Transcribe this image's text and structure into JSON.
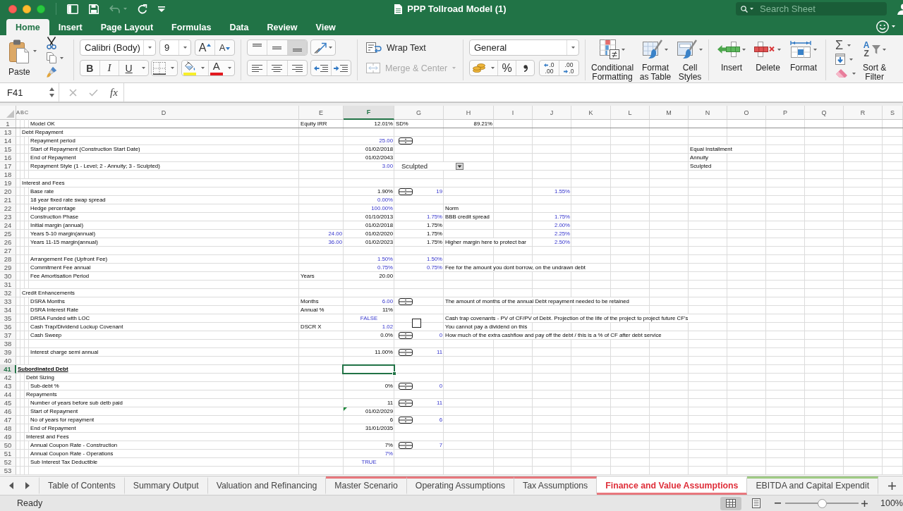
{
  "window": {
    "title": "PPP Tollroad Model (1)",
    "search_placeholder": "Search Sheet"
  },
  "quick_access": [
    {
      "kind": "sidebar",
      "disabled": false
    },
    {
      "kind": "save",
      "disabled": false
    },
    {
      "kind": "undo",
      "disabled": true
    },
    {
      "kind": "redo",
      "disabled": false
    },
    {
      "kind": "customize",
      "disabled": false
    }
  ],
  "ribbon_tabs": [
    {
      "label": "Home",
      "selected": true
    },
    {
      "label": "Insert",
      "selected": false
    },
    {
      "label": "Page Layout",
      "selected": false
    },
    {
      "label": "Formulas",
      "selected": false
    },
    {
      "label": "Data",
      "selected": false
    },
    {
      "label": "Review",
      "selected": false
    },
    {
      "label": "View",
      "selected": false
    }
  ],
  "ribbon": {
    "paste": "Paste",
    "font_name": "Calibri (Body)",
    "font_size": "9",
    "grow_font": "A",
    "shrink_font": "A",
    "bold": "B",
    "italic": "I",
    "underline": "U",
    "font_color": "A",
    "vertical_align": [
      {
        "kind": "top",
        "selected": false
      },
      {
        "kind": "middle",
        "selected": false
      },
      {
        "kind": "bottom",
        "selected": true
      }
    ],
    "horizontal_align": [
      {
        "kind": "left",
        "selected": false
      },
      {
        "kind": "center",
        "selected": false
      },
      {
        "kind": "right",
        "selected": false
      }
    ],
    "wrap_text": "Wrap Text",
    "merge_center": {
      "label": "Merge & Center",
      "disabled": true
    },
    "number_format": "General",
    "percent": "%",
    "add_decimal": [
      ".0",
      ".00"
    ],
    "remove_decimal": [
      ".00",
      ".0"
    ],
    "styles": [
      {
        "kind": "conditional",
        "label": "Conditional\nFormatting"
      },
      {
        "kind": "table",
        "label": "Format\nas Table"
      },
      {
        "kind": "cell_styles",
        "label": "Cell\nStyles"
      }
    ],
    "cells": [
      {
        "kind": "insert",
        "label": "Insert"
      },
      {
        "kind": "delete",
        "label": "Delete"
      },
      {
        "kind": "format",
        "label": "Format"
      }
    ],
    "autosum": "Σ",
    "sort_letters": [
      "A",
      "Z"
    ],
    "sort_filter": "Sort &\nFilter"
  },
  "formula_bar": {
    "name_box": "F41",
    "fx": "fx"
  },
  "sheet": {
    "columns": [
      {
        "letter": "A",
        "selected": false
      },
      {
        "letter": "B",
        "selected": false
      },
      {
        "letter": "C",
        "selected": false
      },
      {
        "letter": "D",
        "selected": false
      },
      {
        "letter": "E",
        "selected": false
      },
      {
        "letter": "F",
        "selected": true
      },
      {
        "letter": "G",
        "selected": false
      },
      {
        "letter": "H",
        "selected": false
      },
      {
        "letter": "I",
        "selected": false
      },
      {
        "letter": "J",
        "selected": false
      },
      {
        "letter": "K",
        "selected": false
      },
      {
        "letter": "L",
        "selected": false
      },
      {
        "letter": "M",
        "selected": false
      },
      {
        "letter": "N",
        "selected": false
      },
      {
        "letter": "O",
        "selected": false
      },
      {
        "letter": "P",
        "selected": false
      },
      {
        "letter": "Q",
        "selected": false
      },
      {
        "letter": "R",
        "selected": false
      },
      {
        "letter": "S",
        "selected": false
      }
    ],
    "rows": [
      {
        "number": "1",
        "selected": false,
        "cells": {
          "D": {
            "kind": "label",
            "text": "Model OK",
            "input": false
          },
          "E": {
            "kind": "label",
            "text": "Equity IRR",
            "input": false
          },
          "F": {
            "kind": "number",
            "text": "12.01%",
            "input": false
          },
          "G": {
            "kind": "label",
            "text": "SD%",
            "input": false
          },
          "H": {
            "kind": "number",
            "text": "89.21%",
            "input": false
          }
        }
      },
      {
        "number": "13",
        "selected": false,
        "cells": {
          "B": {
            "kind": "label",
            "text": "Debt Repayment",
            "input": false
          }
        }
      },
      {
        "number": "14",
        "selected": false,
        "cells": {
          "D": {
            "kind": "label",
            "text": "Repayment period",
            "input": false
          },
          "F": {
            "kind": "number",
            "text": "25.00",
            "input": true
          },
          "G": {
            "kind": "spinner"
          }
        }
      },
      {
        "number": "15",
        "selected": false,
        "cells": {
          "D": {
            "kind": "label",
            "text": "Start of Repayment (Construction Start Date)",
            "input": false
          },
          "F": {
            "kind": "number",
            "text": "01/02/2018",
            "input": false
          },
          "N": {
            "kind": "label",
            "text": "Equal Installment",
            "input": false
          }
        }
      },
      {
        "number": "16",
        "selected": false,
        "cells": {
          "D": {
            "kind": "label",
            "text": "End of Repayment",
            "input": false
          },
          "F": {
            "kind": "number",
            "text": "01/02/2043",
            "input": false
          },
          "N": {
            "kind": "label",
            "text": "Annuity",
            "input": false
          }
        }
      },
      {
        "number": "17",
        "selected": false,
        "cells": {
          "D": {
            "kind": "label",
            "text": "Repayment Style (1 - Level; 2 - Annuity; 3 - Sculpted)",
            "input": false
          },
          "F": {
            "kind": "number",
            "text": "3.00",
            "input": true
          },
          "G": {
            "kind": "dropdown",
            "text": "Sculpted"
          },
          "N": {
            "kind": "label",
            "text": "Sculpted",
            "input": false
          }
        }
      },
      {
        "number": "18",
        "selected": false
      },
      {
        "number": "19",
        "selected": false,
        "cells": {
          "B": {
            "kind": "label",
            "text": "Interest and Fees",
            "input": false
          }
        }
      },
      {
        "number": "20",
        "selected": false,
        "cells": {
          "D": {
            "kind": "label",
            "text": "Base rate",
            "input": false
          },
          "F": {
            "kind": "number",
            "text": "1.90%",
            "input": false
          },
          "G": [
            {
              "kind": "spinner"
            },
            {
              "kind": "number",
              "text": "19",
              "input": true
            }
          ],
          "J": {
            "kind": "number",
            "text": "1.55%",
            "input": true
          }
        }
      },
      {
        "number": "21",
        "selected": false,
        "cells": {
          "D": {
            "kind": "label",
            "text": "18 year fixed rate swap spread",
            "input": false
          },
          "F": {
            "kind": "number",
            "text": "0.00%",
            "input": true
          }
        }
      },
      {
        "number": "22",
        "selected": false,
        "cells": {
          "D": {
            "kind": "label",
            "text": "Hedge percentage",
            "input": false
          },
          "F": {
            "kind": "number",
            "text": "100.00%",
            "input": true
          },
          "H": {
            "kind": "label",
            "text": "Norm",
            "input": false
          }
        }
      },
      {
        "number": "23",
        "selected": false,
        "cells": {
          "D": {
            "kind": "label",
            "text": "Construction Phase",
            "input": false
          },
          "F": {
            "kind": "number",
            "text": "01/10/2013",
            "input": false
          },
          "G": {
            "kind": "number",
            "text": "1.75%",
            "input": true
          },
          "H": {
            "kind": "label",
            "text": "BBB credit spread",
            "input": false
          },
          "J": {
            "kind": "number",
            "text": "1.75%",
            "input": true
          }
        }
      },
      {
        "number": "24",
        "selected": false,
        "cells": {
          "D": {
            "kind": "label",
            "text": "Initial margin (annual)",
            "input": false
          },
          "F": {
            "kind": "number",
            "text": "01/02/2018",
            "input": false
          },
          "G": {
            "kind": "number",
            "text": "1.75%",
            "input": false
          },
          "J": {
            "kind": "number",
            "text": "2.00%",
            "input": true
          }
        }
      },
      {
        "number": "25",
        "selected": false,
        "cells": {
          "D": {
            "kind": "label",
            "text": "Years 5-10 margin(annual)",
            "input": false
          },
          "E": {
            "kind": "number",
            "text": "24.00",
            "input": true
          },
          "F": {
            "kind": "number",
            "text": "01/02/2020",
            "input": false
          },
          "G": {
            "kind": "number",
            "text": "1.75%",
            "input": false
          },
          "J": {
            "kind": "number",
            "text": "2.25%",
            "input": true
          }
        }
      },
      {
        "number": "26",
        "selected": false,
        "cells": {
          "D": {
            "kind": "label",
            "text": "Years 11-15 margin(annual)",
            "input": false
          },
          "E": {
            "kind": "number",
            "text": "36.00",
            "input": true
          },
          "F": {
            "kind": "number",
            "text": "01/02/2023",
            "input": false
          },
          "G": {
            "kind": "number",
            "text": "1.75%",
            "input": false
          },
          "H": {
            "kind": "label",
            "text": "Higher margin here to protect bar",
            "input": false
          },
          "J": {
            "kind": "number",
            "text": "2.50%",
            "input": true
          }
        }
      },
      {
        "number": "27",
        "selected": false
      },
      {
        "number": "28",
        "selected": false,
        "cells": {
          "D": {
            "kind": "label",
            "text": "Arrangement Fee (Upfront Fee)",
            "input": false
          },
          "F": {
            "kind": "number",
            "text": "1.50%",
            "input": true
          },
          "G": {
            "kind": "number",
            "text": "1.50%",
            "input": true
          }
        }
      },
      {
        "number": "29",
        "selected": false,
        "cells": {
          "D": {
            "kind": "label",
            "text": "Commitment Fee annual",
            "input": false
          },
          "F": {
            "kind": "number",
            "text": "0.75%",
            "input": true
          },
          "G": {
            "kind": "number",
            "text": "0.75%",
            "input": true
          },
          "H": {
            "kind": "label",
            "text": "Fee for the amount you dont borrow, on the undrawn debt",
            "input": false
          }
        }
      },
      {
        "number": "30",
        "selected": false,
        "cells": {
          "D": {
            "kind": "label",
            "text": "Fee Amortisation Period",
            "input": false
          },
          "E": {
            "kind": "label",
            "text": "Years",
            "input": false
          },
          "F": {
            "kind": "number",
            "text": "20.00",
            "input": false
          }
        }
      },
      {
        "number": "31",
        "selected": false
      },
      {
        "number": "32",
        "selected": false,
        "cells": {
          "B": {
            "kind": "label",
            "text": "Credit Enhancements",
            "input": false
          }
        }
      },
      {
        "number": "33",
        "selected": false,
        "cells": {
          "D": {
            "kind": "label",
            "text": "DSRA Months",
            "input": false
          },
          "E": {
            "kind": "label",
            "text": "Months",
            "input": false
          },
          "F": {
            "kind": "number",
            "text": "6.00",
            "input": true
          },
          "G": {
            "kind": "spinner"
          },
          "H": {
            "kind": "label",
            "text": "The amount of months of the annual Debt repayment needed to be retained",
            "input": false
          }
        }
      },
      {
        "number": "34",
        "selected": false,
        "cells": {
          "D": {
            "kind": "label",
            "text": "DSRA Interest Rate",
            "input": false
          },
          "E": {
            "kind": "label",
            "text": "Annual %",
            "input": false
          },
          "F": {
            "kind": "number",
            "text": "11%",
            "input": false
          }
        }
      },
      {
        "number": "35",
        "selected": false,
        "cells": {
          "D": {
            "kind": "label",
            "text": "DRSA Funded with LOC",
            "input": false
          },
          "F": {
            "kind": "boolean",
            "text": "FALSE",
            "input": true
          },
          "G": {
            "kind": "checkbox",
            "checked": false
          },
          "H": {
            "kind": "label",
            "text": "Cash trap covenants - PV of CF/PV of Debt. Projection of the life of the project to project future CF's",
            "input": false
          }
        }
      },
      {
        "number": "36",
        "selected": false,
        "cells": {
          "D": {
            "kind": "label",
            "text": "Cash Trap/Dividend Lockup Covenant",
            "input": false
          },
          "E": {
            "kind": "label",
            "text": "DSCR X",
            "input": false
          },
          "F": {
            "kind": "number",
            "text": "1.02",
            "input": true
          },
          "H": {
            "kind": "label",
            "text": "You cannot pay a dividend on this",
            "input": false
          }
        }
      },
      {
        "number": "37",
        "selected": false,
        "cells": {
          "D": {
            "kind": "label",
            "text": "Cash Sweep",
            "input": false
          },
          "F": {
            "kind": "number",
            "text": "0.0%",
            "input": false
          },
          "G": [
            {
              "kind": "spinner"
            },
            {
              "kind": "number",
              "text": "0",
              "input": true
            }
          ],
          "H": {
            "kind": "label",
            "text": "How much of the extra cashflow and pay off the debt / this is a % of CF after debt service",
            "input": false
          }
        }
      },
      {
        "number": "38",
        "selected": false
      },
      {
        "number": "39",
        "selected": false,
        "cells": {
          "D": {
            "kind": "label",
            "text": "Interest charge semi annual",
            "input": false
          },
          "F": {
            "kind": "number",
            "text": "11.00%",
            "input": false
          },
          "G": [
            {
              "kind": "spinner"
            },
            {
              "kind": "number",
              "text": "11",
              "input": true
            }
          ]
        }
      },
      {
        "number": "40",
        "selected": false
      },
      {
        "number": "41",
        "selected": true,
        "cells": {
          "A": {
            "kind": "heading",
            "text": "Subordinated Debt",
            "input": false
          }
        }
      },
      {
        "number": "42",
        "selected": false,
        "cells": {
          "C": {
            "kind": "label",
            "text": "Debt Sizing",
            "input": false
          }
        }
      },
      {
        "number": "43",
        "selected": false,
        "cells": {
          "D": {
            "kind": "label",
            "text": "Sub-debt %",
            "input": false
          },
          "F": {
            "kind": "number",
            "text": "0%",
            "input": false
          },
          "G": [
            {
              "kind": "spinner"
            },
            {
              "kind": "number",
              "text": "0",
              "input": true
            }
          ]
        }
      },
      {
        "number": "44",
        "selected": false,
        "cells": {
          "C": {
            "kind": "label",
            "text": "Repayments",
            "input": false
          }
        }
      },
      {
        "number": "45",
        "selected": false,
        "cells": {
          "D": {
            "kind": "label",
            "text": "Number of years before sub detb paid",
            "input": false
          },
          "F": {
            "kind": "number",
            "text": "11",
            "input": false
          },
          "G": [
            {
              "kind": "spinner"
            },
            {
              "kind": "number",
              "text": "11",
              "input": true
            }
          ]
        }
      },
      {
        "number": "46",
        "selected": false,
        "cells": {
          "D": {
            "kind": "label",
            "text": "Start of Repayment",
            "input": false
          },
          "F": [
            {
              "kind": "number",
              "text": "01/02/2029",
              "input": false
            },
            {
              "kind": "error_flag"
            }
          ]
        }
      },
      {
        "number": "47",
        "selected": false,
        "cells": {
          "D": {
            "kind": "label",
            "text": "No of years for repayment",
            "input": false
          },
          "F": {
            "kind": "number",
            "text": "6",
            "input": false
          },
          "G": [
            {
              "kind": "spinner"
            },
            {
              "kind": "number",
              "text": "6",
              "input": true
            }
          ]
        }
      },
      {
        "number": "48",
        "selected": false,
        "cells": {
          "D": {
            "kind": "label",
            "text": "End of Repayment",
            "input": false
          },
          "F": {
            "kind": "number",
            "text": "31/01/2035",
            "input": false
          }
        }
      },
      {
        "number": "49",
        "selected": false,
        "cells": {
          "C": {
            "kind": "label",
            "text": "Interest and Fees",
            "input": false
          }
        }
      },
      {
        "number": "50",
        "selected": false,
        "cells": {
          "D": {
            "kind": "label",
            "text": "Annual Coupon Rate - Construction",
            "input": false
          },
          "F": {
            "kind": "number",
            "text": "7%",
            "input": false
          },
          "G": [
            {
              "kind": "spinner"
            },
            {
              "kind": "number",
              "text": "7",
              "input": true
            }
          ]
        }
      },
      {
        "number": "51",
        "selected": false,
        "cells": {
          "D": {
            "kind": "label",
            "text": "Annual Coupon Rate - Operations",
            "input": false
          },
          "F": {
            "kind": "number",
            "text": "7%",
            "input": true
          }
        }
      },
      {
        "number": "52",
        "selected": false,
        "cells": {
          "D": {
            "kind": "label",
            "text": "Sub Interest Tax Deductible",
            "input": false
          },
          "F": {
            "kind": "boolean",
            "text": "TRUE",
            "input": true
          }
        }
      },
      {
        "number": "53",
        "selected": false
      }
    ]
  },
  "sheet_tabs": [
    {
      "label": "Table of Contents",
      "selected": false
    },
    {
      "label": "Summary Output",
      "selected": false
    },
    {
      "label": "Valuation and Refinancing",
      "selected": false
    },
    {
      "label": "Master Scenario",
      "selected": false,
      "color": "#e8777d"
    },
    {
      "label": "Operating Assumptions",
      "selected": false,
      "color": "#e8777d"
    },
    {
      "label": "Tax Assumptions",
      "selected": false,
      "color": "#e8777d"
    },
    {
      "label": "Finance and Value Assumptions",
      "selected": true,
      "color": "#e8777d"
    },
    {
      "label": "EBITDA and Capital Expendit",
      "selected": false,
      "color": "#9fcb84"
    }
  ],
  "status_bar": {
    "text": "Ready",
    "views": [
      {
        "kind": "normal",
        "selected": true
      },
      {
        "kind": "page_layout",
        "selected": false
      }
    ],
    "zoom": {
      "level": 0.5,
      "reading": "100%"
    }
  }
}
